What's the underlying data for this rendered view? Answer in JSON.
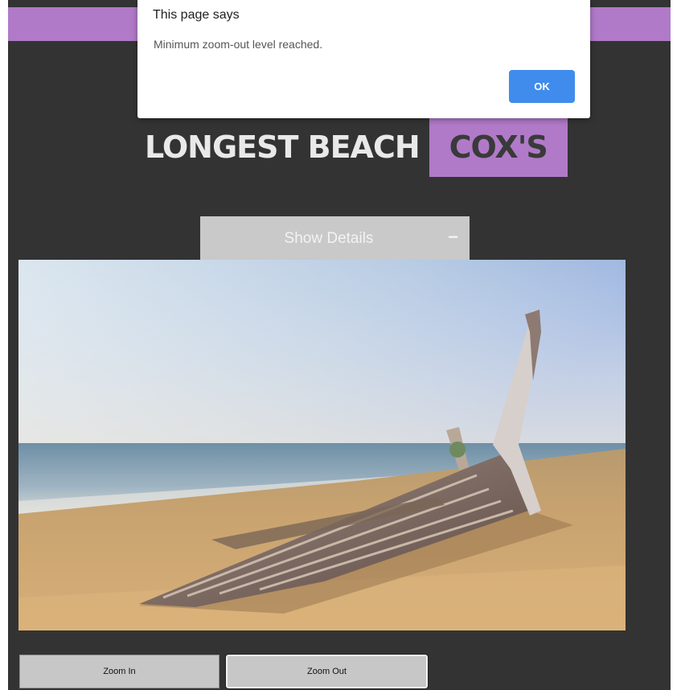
{
  "header": {
    "title": "LONGEST BEACH",
    "badge": "COX'S"
  },
  "details": {
    "label": "Show Details",
    "toggle_symbol": "−"
  },
  "controls": {
    "zoom_in_label": "Zoom In",
    "zoom_out_label": "Zoom Out"
  },
  "alert": {
    "title": "This page says",
    "message": "Minimum zoom-out level reached.",
    "ok_label": "OK"
  },
  "colors": {
    "accent": "#b07ac8",
    "background": "#333333",
    "details_bar": "#c9c9c9",
    "ok_button": "#3f8ced"
  },
  "photo": {
    "subject": "beach-boat-photo"
  }
}
